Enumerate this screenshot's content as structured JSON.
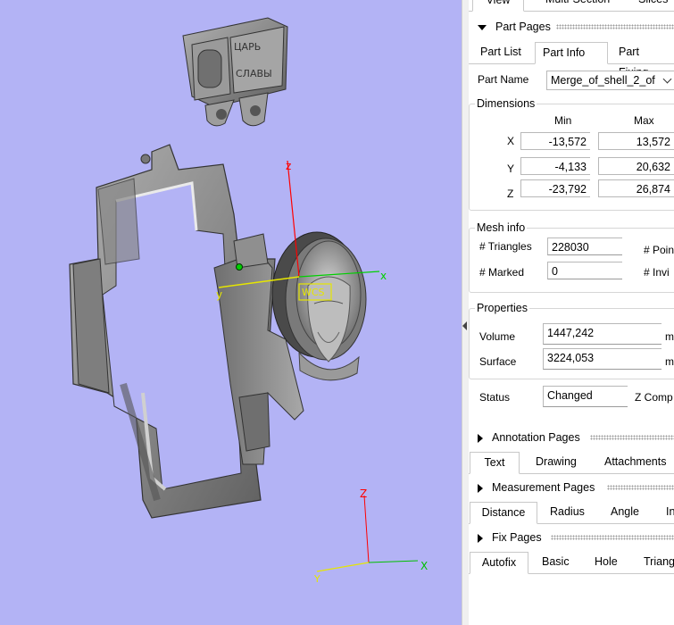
{
  "viewport": {
    "wcs_label": "WCS",
    "axis_labels": {
      "x": "x",
      "y": "y",
      "z": "z",
      "ref_x": "X",
      "ref_y": "Y",
      "ref_z": "Z"
    },
    "engraving_top": [
      "ЦАРЬ",
      "СЛАВЫ"
    ],
    "colors": {
      "background": "#b3b3f5",
      "axis_x": "#00c000",
      "axis_y": "#e6e600",
      "axis_z": "#ff0000",
      "model": "#8a8a8a",
      "wcs": "#e6e600"
    }
  },
  "top_tabs": [
    "View",
    "Multi-Section",
    "Slices"
  ],
  "part_pages": {
    "title": "Part Pages",
    "tabs": [
      "Part List",
      "Part Info",
      "Part Fixing"
    ],
    "active_tab": "Part Info",
    "part_name_label": "Part Name",
    "part_name_value": "Merge_of_shell_2_of",
    "dimensions": {
      "title": "Dimensions",
      "col_min": "Min",
      "col_max": "Max",
      "rows": [
        {
          "axis": "X",
          "min": "-13,572",
          "max": "13,572"
        },
        {
          "axis": "Y",
          "min": "-4,133",
          "max": "20,632"
        },
        {
          "axis": "Z",
          "min": "-23,792",
          "max": "26,874"
        }
      ]
    },
    "mesh_info": {
      "title": "Mesh info",
      "triangles_label": "# Triangles",
      "triangles_value": "228030",
      "points_label": "# Poin",
      "marked_label": "# Marked",
      "marked_value": "0",
      "invalid_label": "# Invi"
    },
    "properties": {
      "title": "Properties",
      "volume_label": "Volume",
      "volume_value": "1447,242",
      "volume_unit": "m",
      "surface_label": "Surface",
      "surface_value": "3224,053",
      "surface_unit": "m"
    },
    "status_label": "Status",
    "status_value": "Changed",
    "z_comp_label": "Z Comp"
  },
  "annotation_pages": {
    "title": "Annotation Pages",
    "tabs": [
      "Text",
      "Drawing",
      "Attachments"
    ],
    "active_tab": "Text"
  },
  "measurement_pages": {
    "title": "Measurement Pages",
    "tabs": [
      "Distance",
      "Radius",
      "Angle",
      "In"
    ],
    "active_tab": "Distance"
  },
  "fix_pages": {
    "title": "Fix Pages",
    "tabs": [
      "Autofix",
      "Basic",
      "Hole",
      "Triang"
    ],
    "active_tab": "Autofix"
  }
}
